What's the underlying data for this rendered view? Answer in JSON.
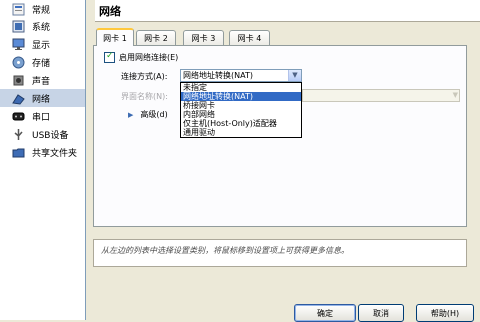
{
  "sidebar": {
    "items": [
      {
        "label": "常规",
        "icon": "general-icon"
      },
      {
        "label": "系统",
        "icon": "system-icon"
      },
      {
        "label": "显示",
        "icon": "display-icon"
      },
      {
        "label": "存储",
        "icon": "storage-icon"
      },
      {
        "label": "声音",
        "icon": "audio-icon"
      },
      {
        "label": "网络",
        "icon": "network-icon"
      },
      {
        "label": "串口",
        "icon": "serial-port-icon"
      },
      {
        "label": "USB设备",
        "icon": "usb-icon"
      },
      {
        "label": "共享文件夹",
        "icon": "shared-folder-icon"
      }
    ],
    "selected_index": 5
  },
  "header": {
    "title": "网络"
  },
  "tabs": [
    {
      "label": "网卡 1"
    },
    {
      "label": "网卡 2"
    },
    {
      "label": "网卡 3"
    },
    {
      "label": "网卡 4"
    }
  ],
  "adapter": {
    "enable_label": "启用网络连接(E)",
    "enabled": true,
    "attached_label": "连接方式(A):",
    "attached_value": "网络地址转换(NAT)",
    "name_label": "界面名称(N):",
    "advanced_label": "高级(d)"
  },
  "dropdown": {
    "options": [
      "未指定",
      "网络地址转换(NAT)",
      "桥接网卡",
      "内部网络",
      "仅主机(Host-Only)适配器",
      "通用驱动"
    ],
    "highlighted_index": 1
  },
  "info": {
    "text": "从左边的列表中选择设置类别，将鼠标移到设置项上可获得更多信息。"
  },
  "buttons": {
    "ok": "确定",
    "cancel": "取消",
    "help": "帮助(H)"
  },
  "colors": {
    "selection": "#316ac5",
    "sidebar_selected": "#c7d4e6",
    "tab_accent": "#ffc83c"
  }
}
